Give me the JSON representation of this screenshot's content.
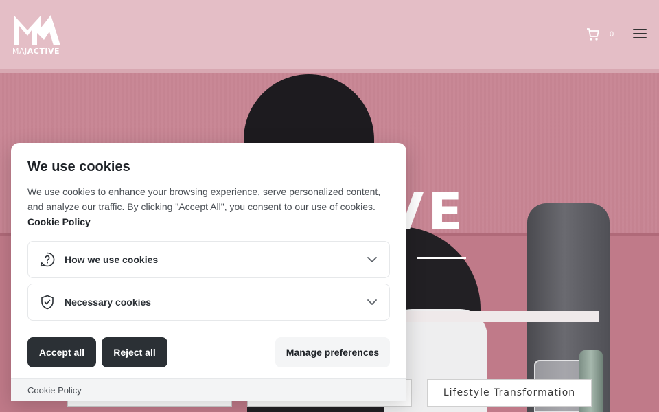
{
  "header": {
    "logo_text_light": "MAJ",
    "logo_text_bold": "ACTIVE",
    "cart_count": "0"
  },
  "hero": {
    "heading_fragment": "VE",
    "button_3_label": "Lifestyle Transformation"
  },
  "cookie_banner": {
    "title": "We use cookies",
    "description": "We use cookies to enhance your browsing experience, serve personalized content, and analyze our traffic. By clicking \"Accept All\", you consent to our use of cookies.",
    "policy_link": "Cookie Policy",
    "sections": [
      {
        "label": "How we use cookies",
        "icon": "question-bubble-icon"
      },
      {
        "label": "Necessary cookies",
        "icon": "shield-check-icon"
      }
    ],
    "accept_label": "Accept all",
    "reject_label": "Reject all",
    "manage_label": "Manage preferences",
    "footer_link": "Cookie Policy"
  },
  "colors": {
    "primary_button": "#2b3035",
    "secondary_button": "#f4f5f6",
    "hero_pink": "#c98896"
  }
}
